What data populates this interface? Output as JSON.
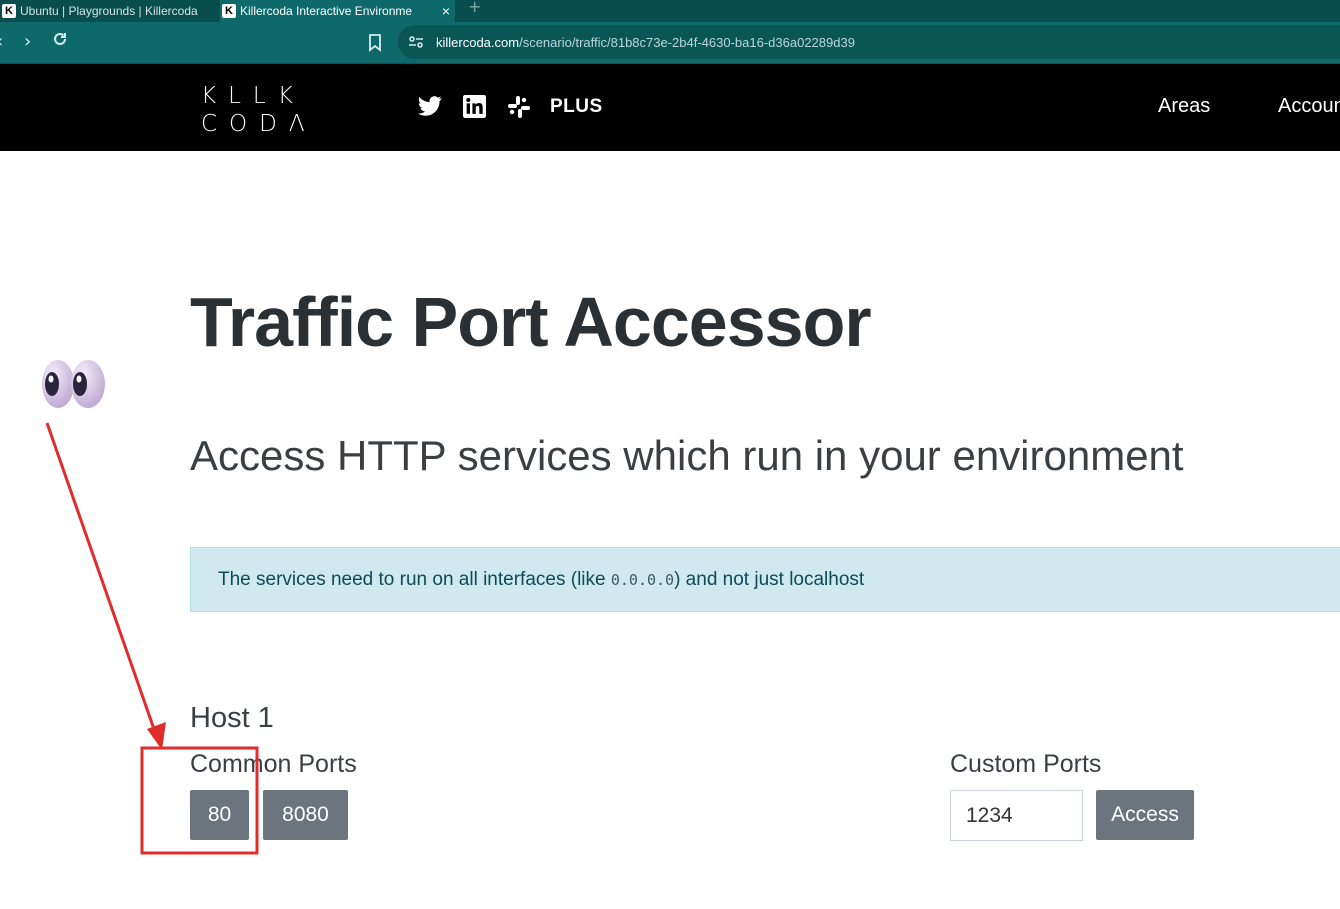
{
  "browser": {
    "tabs": [
      {
        "title": "Ubuntu | Playgrounds | Killercoda",
        "active": false
      },
      {
        "title": "Killercoda Interactive Environme",
        "active": true
      }
    ],
    "close_glyph": "×",
    "new_tab_glyph": "+",
    "url_host": "killercoda.com",
    "url_path": "/scenario/traffic/81b8c73e-2b4f-4630-ba16-d36a02289d39"
  },
  "site": {
    "logo_line1": "KLLK",
    "logo_line2": "CODΛ",
    "social_icons": [
      "twitter-icon",
      "linkedin-icon",
      "slack-icon"
    ],
    "plus_label": "PLUS",
    "nav": {
      "areas": "Areas",
      "account": "Account"
    }
  },
  "main": {
    "title": "Traffic Port Accessor",
    "subtitle": "Access HTTP services which run in your environment",
    "alert": {
      "before": "The services need to run on all interfaces (like ",
      "code": "0.0.0.0",
      "after": ") and not just localhost"
    },
    "host": {
      "heading": "Host 1",
      "common_label": "Common Ports",
      "common_ports": [
        "80",
        "8080"
      ],
      "custom_label": "Custom Ports",
      "custom_value": "1234",
      "access_label": "Access"
    }
  },
  "colors": {
    "browser_frame": "#0e6a6a",
    "header_bg": "#000000",
    "button_bg": "#6c757d",
    "alert_bg": "#cfe9ee",
    "annotation_red": "#e12c2c"
  }
}
